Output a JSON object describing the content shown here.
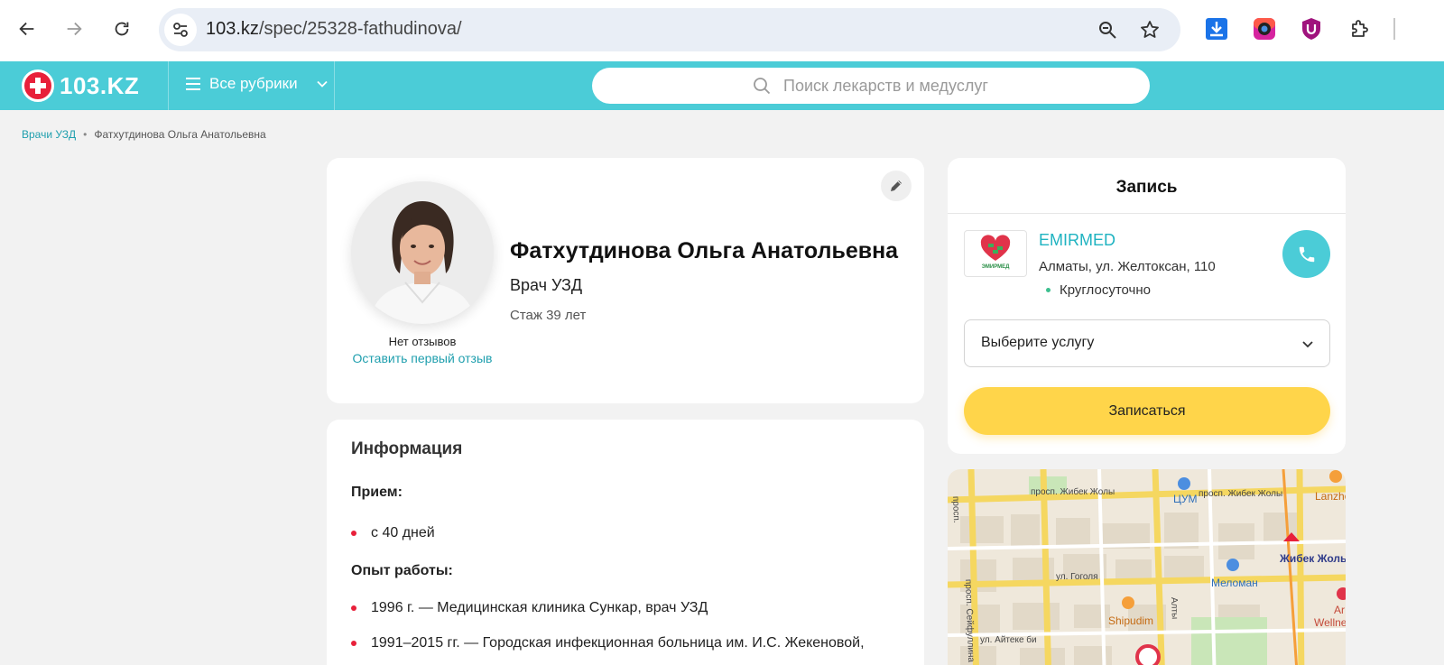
{
  "browser": {
    "url_host": "103.kz",
    "url_path": "/spec/25328-fathudinova/"
  },
  "header": {
    "logo_text": "103.KZ",
    "rubrics_label": "Все рубрики",
    "search_placeholder": "Поиск лекарств и медуслуг"
  },
  "breadcrumb": {
    "items": [
      "Врачи УЗД",
      "Фатхутдинова Ольга Анатольевна"
    ]
  },
  "doctor": {
    "name": "Фатхутдинова Ольга Анатольевна",
    "specialty": "Врач УЗД",
    "experience": "Стаж 39 лет",
    "no_reviews": "Нет отзывов",
    "leave_review": "Оставить первый отзыв"
  },
  "info": {
    "title": "Информация",
    "reception_label": "Прием:",
    "reception_items": [
      "с 40 дней"
    ],
    "experience_label": "Опыт работы:",
    "experience_items": [
      "1996 г. — Медицинская клиника Сункар, врач УЗД",
      "1991–2015 гг. — Городская инфекционная больница им. И.С. Жекеновой,"
    ]
  },
  "booking": {
    "title": "Запись",
    "clinic_name": "EMIRMED",
    "clinic_logo_text": "ЭМИРМЕД",
    "clinic_address": "Алматы, ул. Желтоксан, 110",
    "clinic_hours": "Круглосуточно",
    "service_placeholder": "Выберите услугу",
    "book_button": "Записаться"
  },
  "map": {
    "labels": {
      "zhibek_zholy_1": "просп. Жибек Жолы",
      "zhibek_zholy_2": "просп. Жибек Жолы",
      "seifullina": "просп. Сейфуллина",
      "gogolya": "ул. Гоголя",
      "aiteke_bi": "ул. Айтеке би",
      "tsum": "ЦУМ",
      "zhibek_zholy_metro": "Жибек Жолы",
      "meloman": "Меломан",
      "shipudim": "Shipudim",
      "lanzhou": "Lanzho",
      "wellness": "Wellne",
      "ar": "Ar",
      "prosp_short": "просп.",
      "altyn": "Алты"
    }
  },
  "colors": {
    "brand_teal": "#4bccd7",
    "brand_red": "#e8203a",
    "link": "#1f9fae",
    "button_yellow": "#ffd54a"
  }
}
